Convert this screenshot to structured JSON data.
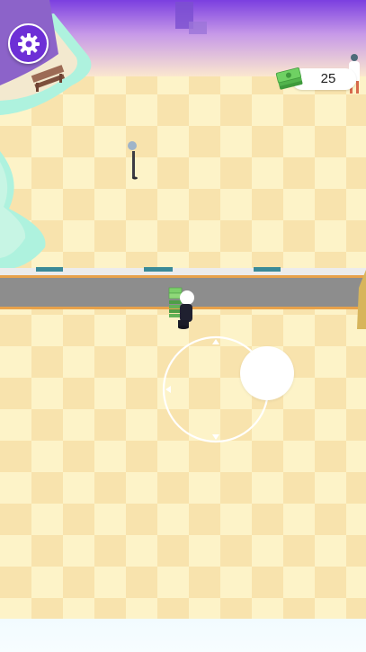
{
  "hud": {
    "settings_icon": "gear-icon",
    "cash_icon": "cash-stack-icon",
    "cash_amount": "25"
  },
  "joystick": {
    "arrow_icons": [
      "arrow-up-icon",
      "arrow-left-icon",
      "arrow-down-icon"
    ]
  },
  "colors": {
    "floor_light": "#fdf4c9",
    "floor_dark": "#f8e4ad",
    "sky_top": "#7b3fe0",
    "road": "#8c8c8c",
    "road_edge": "#e8a24b",
    "water": "#a9f1dc",
    "settings_button": "#6d2fd6"
  }
}
